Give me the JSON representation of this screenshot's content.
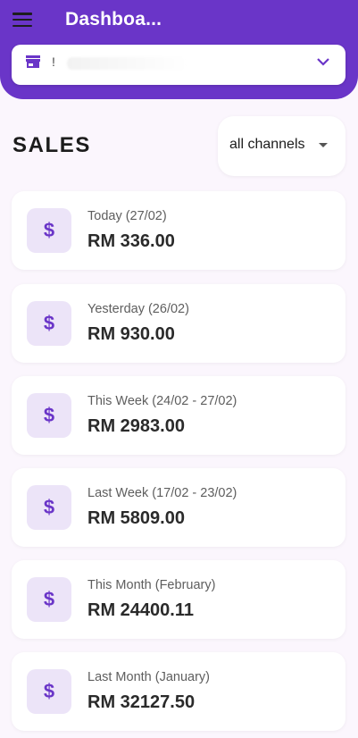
{
  "header": {
    "title": "Dashboa...",
    "store_select": {
      "value": "!"
    }
  },
  "sales": {
    "title": "SALES",
    "channel": "all channels"
  },
  "cards": [
    {
      "label": "Today (27/02)",
      "value": "RM 336.00",
      "icon": "$"
    },
    {
      "label": "Yesterday (26/02)",
      "value": "RM 930.00",
      "icon": "$"
    },
    {
      "label": "This Week (24/02 - 27/02)",
      "value": "RM 2983.00",
      "icon": "$"
    },
    {
      "label": "Last Week (17/02 - 23/02)",
      "value": "RM 5809.00",
      "icon": "$"
    },
    {
      "label": "This Month (February)",
      "value": "RM 24400.11",
      "icon": "$"
    },
    {
      "label": "Last Month (January)",
      "value": "RM 32127.50",
      "icon": "$"
    }
  ],
  "colors": {
    "primary": "#6a35c8",
    "icon_bg": "#ece4f8",
    "background": "#fbf6fd"
  }
}
